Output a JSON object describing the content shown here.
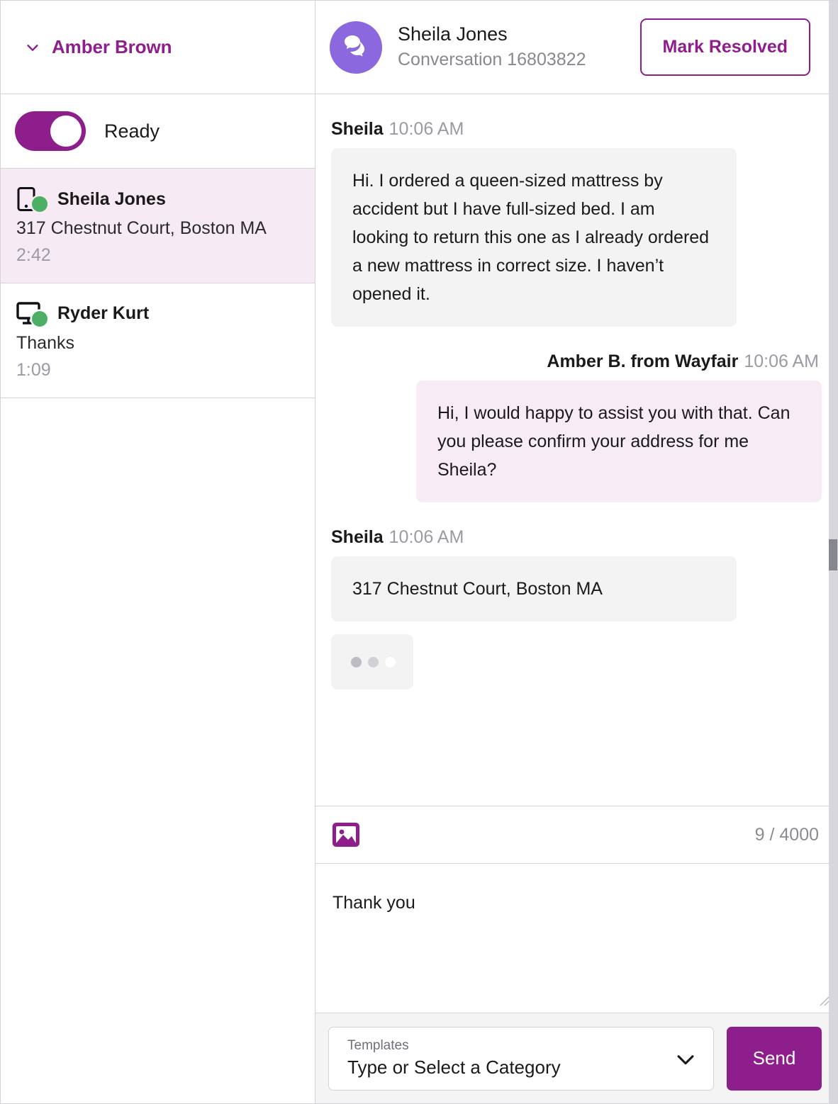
{
  "sidebar": {
    "agent": {
      "name": "Amber Brown",
      "chevron_icon": "chevron-down-icon"
    },
    "status": {
      "label": "Ready",
      "toggle_on": true,
      "toggle_color": "#8e1e8b"
    },
    "conversations": [
      {
        "name": "Sheila Jones",
        "preview": "317 Chestnut Court, Boston MA",
        "time": "2:42",
        "device_icon": "mobile-phone-icon",
        "presence": "online",
        "presence_color": "#4caf64",
        "selected": true
      },
      {
        "name": "Ryder Kurt",
        "preview": "Thanks",
        "time": "1:09",
        "device_icon": "desktop-monitor-icon",
        "presence": "online",
        "presence_color": "#4caf64",
        "selected": false
      }
    ]
  },
  "conversation_header": {
    "avatar_icon": "chat-bubbles-icon",
    "avatar_color": "#8b68dd",
    "customer_name": "Sheila Jones",
    "conversation_label": "Conversation 16803822",
    "mark_resolved_label": "Mark Resolved"
  },
  "messages": [
    {
      "author": "Sheila",
      "time": "10:06 AM",
      "direction": "incoming",
      "text": "Hi. I ordered a queen-sized mattress by accident but I have full-sized bed. I am looking to return this one as I already ordered a new mattress in correct size. I haven’t opened it."
    },
    {
      "author": "Amber B. from Wayfair",
      "time": "10:06 AM",
      "direction": "outgoing",
      "text": "Hi, I would happy to assist you with that. Can you please confirm your address for me Sheila?"
    },
    {
      "author": "Sheila",
      "time": "10:06 AM",
      "direction": "incoming",
      "text": "317 Chestnut Court, Boston MA",
      "typing_indicator": true
    }
  ],
  "compose": {
    "image_attach_icon": "image-icon",
    "char_count": "9 / 4000",
    "message_value": "Thank you",
    "message_placeholder": "",
    "templates_label": "Templates",
    "templates_value": "Type or Select a Category",
    "templates_chevron_icon": "chevron-down-icon",
    "send_label": "Send",
    "send_color": "#8e1e8b"
  }
}
